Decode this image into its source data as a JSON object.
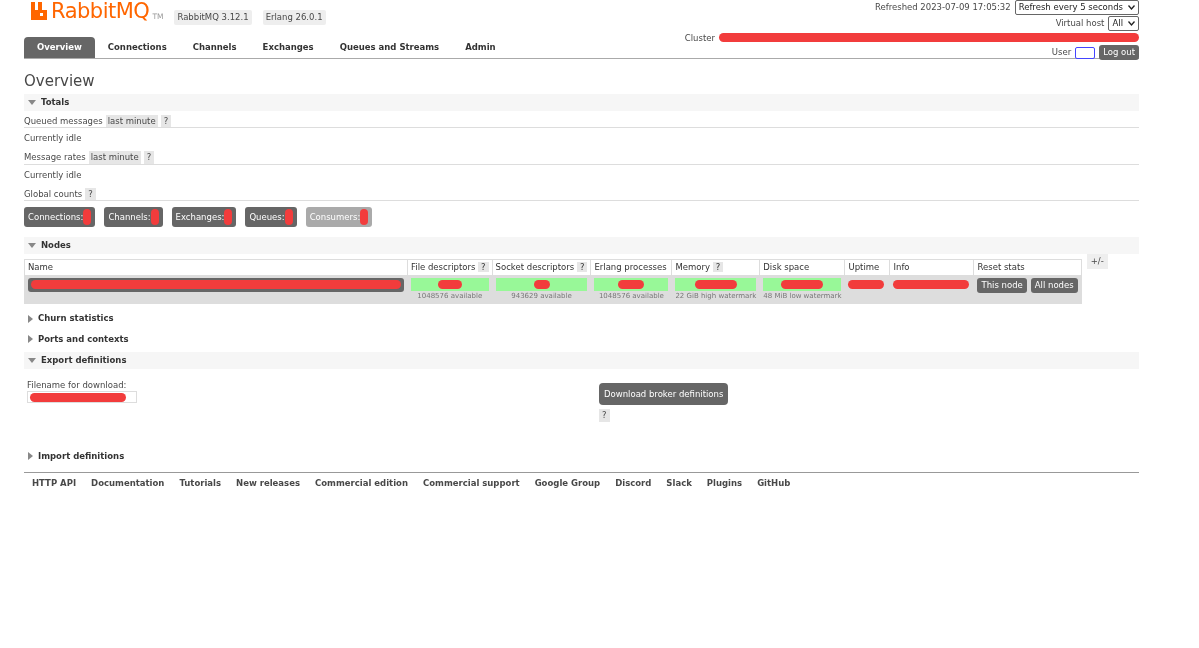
{
  "header": {
    "logo_text": "RabbitMQ",
    "logo_tm": "TM",
    "versions": [
      "RabbitMQ 3.12.1",
      "Erlang 26.0.1"
    ],
    "refreshed": "Refreshed 2023-07-09 17:05:32",
    "refresh_select": "Refresh every 5 seconds",
    "vhost_label": "Virtual host",
    "vhost_select": "All",
    "cluster_label": "Cluster",
    "user_label": "User",
    "logout": "Log out"
  },
  "tabs": [
    {
      "label": "Overview",
      "selected": true
    },
    {
      "label": "Connections",
      "selected": false
    },
    {
      "label": "Channels",
      "selected": false
    },
    {
      "label": "Exchanges",
      "selected": false
    },
    {
      "label": "Queues and Streams",
      "selected": false
    },
    {
      "label": "Admin",
      "selected": false
    }
  ],
  "page_title": "Overview",
  "sections": [
    {
      "kind": "totals",
      "title": "Totals",
      "expanded": true,
      "rows": [
        {
          "label": "Queued messages",
          "badge": "last minute",
          "help": "?",
          "status": "Currently idle"
        },
        {
          "label": "Message rates",
          "badge": "last minute",
          "help": "?",
          "status": "Currently idle"
        },
        {
          "label": "Global counts",
          "help": "?"
        }
      ],
      "counts": [
        {
          "label": "Connections:",
          "disabled": false
        },
        {
          "label": "Channels:",
          "disabled": false
        },
        {
          "label": "Exchanges:",
          "disabled": false
        },
        {
          "label": "Queues:",
          "disabled": false
        },
        {
          "label": "Consumers:",
          "disabled": true
        }
      ]
    },
    {
      "kind": "nodes",
      "title": "Nodes",
      "expanded": true,
      "columns": [
        {
          "label": "Name"
        },
        {
          "label": "File descriptors",
          "help": "?"
        },
        {
          "label": "Socket descriptors",
          "help": "?"
        },
        {
          "label": "Erlang processes"
        },
        {
          "label": "Memory",
          "help": "?"
        },
        {
          "label": "Disk space"
        },
        {
          "label": "Uptime"
        },
        {
          "label": "Info"
        },
        {
          "label": "Reset stats"
        }
      ],
      "toggle": "+/-",
      "row": {
        "bars": [
          "1048576 available",
          "943629 available",
          "1048576 available",
          "22 GiB high watermark",
          "48 MiB low watermark"
        ],
        "buttons": [
          "This node",
          "All nodes"
        ]
      }
    },
    {
      "title": "Churn statistics",
      "expanded": false
    },
    {
      "title": "Ports and contexts",
      "expanded": false
    },
    {
      "kind": "export",
      "title": "Export definitions",
      "expanded": true,
      "field_label": "Filename for download:",
      "button": "Download broker definitions",
      "help": "?"
    },
    {
      "title": "Import definitions",
      "expanded": false
    }
  ],
  "footer": [
    "HTTP API",
    "Documentation",
    "Tutorials",
    "New releases",
    "Commercial edition",
    "Commercial support",
    "Google Group",
    "Discord",
    "Slack",
    "Plugins",
    "GitHub"
  ]
}
